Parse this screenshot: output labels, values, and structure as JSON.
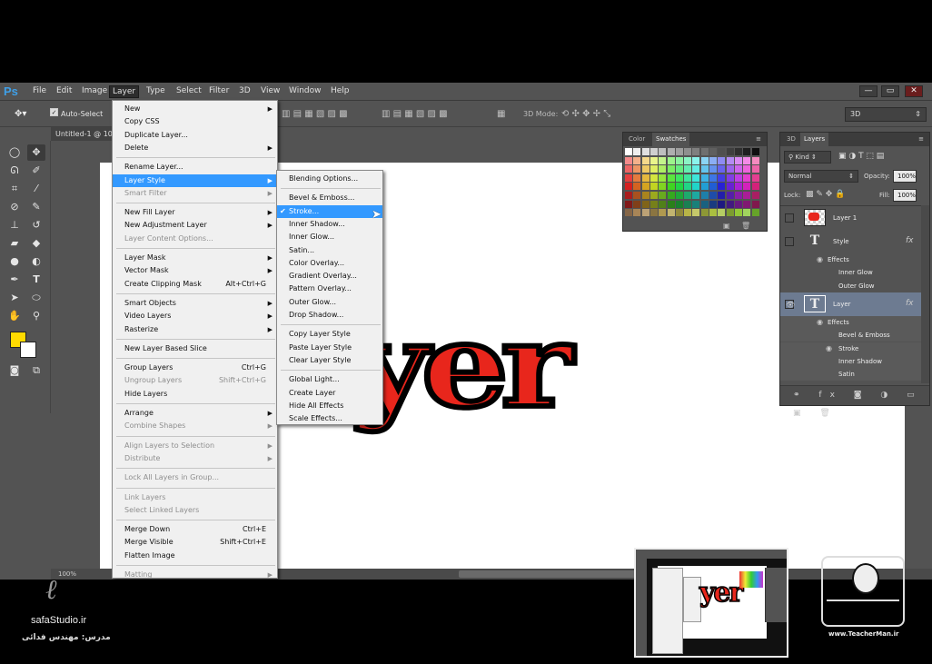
{
  "app": {
    "logo": "Ps",
    "menus": [
      "File",
      "Edit",
      "Image",
      "Layer",
      "Type",
      "Select",
      "Filter",
      "3D",
      "View",
      "Window",
      "Help"
    ],
    "active_menu": "Layer",
    "window_buttons": [
      "—",
      "▭",
      "✕"
    ]
  },
  "options": {
    "auto_select": "Auto-Select",
    "mode_3d_label": "3D Mode:",
    "workspace": "3D"
  },
  "document": {
    "tab": "Untitled-1 @ 10",
    "text": "yer",
    "zoom": "100%"
  },
  "layer_menu": {
    "items": [
      {
        "label": "New",
        "shortcut": "",
        "submenu": true,
        "disabled": false
      },
      {
        "label": "Copy CSS",
        "shortcut": "",
        "submenu": false,
        "disabled": false
      },
      {
        "label": "Duplicate Layer...",
        "shortcut": "",
        "submenu": false,
        "disabled": false
      },
      {
        "label": "Delete",
        "shortcut": "",
        "submenu": true,
        "disabled": false
      },
      {
        "label": "Rename Layer...",
        "shortcut": "",
        "submenu": false,
        "disabled": false
      },
      {
        "label": "Layer Style",
        "shortcut": "",
        "submenu": true,
        "disabled": false,
        "highlight": true
      },
      {
        "label": "Smart Filter",
        "shortcut": "",
        "submenu": true,
        "disabled": true
      },
      {
        "label": "New Fill Layer",
        "shortcut": "",
        "submenu": true,
        "disabled": false
      },
      {
        "label": "New Adjustment Layer",
        "shortcut": "",
        "submenu": true,
        "disabled": false
      },
      {
        "label": "Layer Content Options...",
        "shortcut": "",
        "submenu": false,
        "disabled": true
      },
      {
        "label": "Layer Mask",
        "shortcut": "",
        "submenu": true,
        "disabled": false
      },
      {
        "label": "Vector Mask",
        "shortcut": "",
        "submenu": true,
        "disabled": false
      },
      {
        "label": "Create Clipping Mask",
        "shortcut": "Alt+Ctrl+G",
        "submenu": false,
        "disabled": false
      },
      {
        "label": "Smart Objects",
        "shortcut": "",
        "submenu": true,
        "disabled": false
      },
      {
        "label": "Video Layers",
        "shortcut": "",
        "submenu": true,
        "disabled": false
      },
      {
        "label": "Rasterize",
        "shortcut": "",
        "submenu": true,
        "disabled": false
      },
      {
        "label": "New Layer Based Slice",
        "shortcut": "",
        "submenu": false,
        "disabled": false
      },
      {
        "label": "Group Layers",
        "shortcut": "Ctrl+G",
        "submenu": false,
        "disabled": false
      },
      {
        "label": "Ungroup Layers",
        "shortcut": "Shift+Ctrl+G",
        "submenu": false,
        "disabled": true
      },
      {
        "label": "Hide Layers",
        "shortcut": "",
        "submenu": false,
        "disabled": false
      },
      {
        "label": "Arrange",
        "shortcut": "",
        "submenu": true,
        "disabled": false
      },
      {
        "label": "Combine Shapes",
        "shortcut": "",
        "submenu": true,
        "disabled": true
      },
      {
        "label": "Align Layers to Selection",
        "shortcut": "",
        "submenu": true,
        "disabled": true
      },
      {
        "label": "Distribute",
        "shortcut": "",
        "submenu": true,
        "disabled": true
      },
      {
        "label": "Lock All Layers in Group...",
        "shortcut": "",
        "submenu": false,
        "disabled": true
      },
      {
        "label": "Link Layers",
        "shortcut": "",
        "submenu": false,
        "disabled": true
      },
      {
        "label": "Select Linked Layers",
        "shortcut": "",
        "submenu": false,
        "disabled": true
      },
      {
        "label": "Merge Down",
        "shortcut": "Ctrl+E",
        "submenu": false,
        "disabled": false
      },
      {
        "label": "Merge Visible",
        "shortcut": "Shift+Ctrl+E",
        "submenu": false,
        "disabled": false
      },
      {
        "label": "Flatten Image",
        "shortcut": "",
        "submenu": false,
        "disabled": false
      },
      {
        "label": "Matting",
        "shortcut": "",
        "submenu": true,
        "disabled": true
      }
    ]
  },
  "style_menu": {
    "items": [
      {
        "label": "Blending Options..."
      },
      {
        "label": "Bevel & Emboss..."
      },
      {
        "label": "Stroke...",
        "checked": true,
        "highlight": true
      },
      {
        "label": "Inner Shadow..."
      },
      {
        "label": "Inner Glow..."
      },
      {
        "label": "Satin..."
      },
      {
        "label": "Color Overlay..."
      },
      {
        "label": "Gradient Overlay..."
      },
      {
        "label": "Pattern Overlay..."
      },
      {
        "label": "Outer Glow..."
      },
      {
        "label": "Drop Shadow..."
      },
      {
        "label": "Copy Layer Style"
      },
      {
        "label": "Paste Layer Style"
      },
      {
        "label": "Clear Layer Style"
      },
      {
        "label": "Global Light..."
      },
      {
        "label": "Create Layer"
      },
      {
        "label": "Hide All Effects"
      },
      {
        "label": "Scale Effects..."
      }
    ]
  },
  "swatches_panel": {
    "tabs": [
      "Color",
      "Swatches"
    ],
    "active": "Swatches"
  },
  "layers_panel": {
    "tabs": [
      "3D",
      "Layers"
    ],
    "active": "Layers",
    "filter": "Kind",
    "blend_mode": "Normal",
    "opacity_label": "Opacity:",
    "opacity": "100%",
    "lock_label": "Lock:",
    "fill_label": "Fill:",
    "fill": "100%",
    "rows": [
      {
        "kind": "layer",
        "name": "Layer 1",
        "thumb": "red",
        "visible": false
      },
      {
        "kind": "text",
        "name": "Style",
        "fx": "fx",
        "visible": false
      },
      {
        "kind": "effects",
        "name": "Effects"
      },
      {
        "kind": "effect",
        "name": "Inner Glow"
      },
      {
        "kind": "effect",
        "name": "Outer Glow"
      },
      {
        "kind": "text",
        "name": "Layer",
        "fx": "fx",
        "visible": true,
        "selected": true
      },
      {
        "kind": "effects",
        "name": "Effects"
      },
      {
        "kind": "effect",
        "name": "Bevel & Emboss"
      },
      {
        "kind": "effect",
        "name": "Stroke",
        "eye": true
      },
      {
        "kind": "effect",
        "name": "Inner Shadow"
      },
      {
        "kind": "effect",
        "name": "Satin"
      }
    ]
  },
  "overlay": {
    "studio": "safaStudio.ir",
    "teacher_fa": "مدرس: مهندس فدائی",
    "site": "www.TeacherMan.ir",
    "thumb_text": "yer"
  }
}
